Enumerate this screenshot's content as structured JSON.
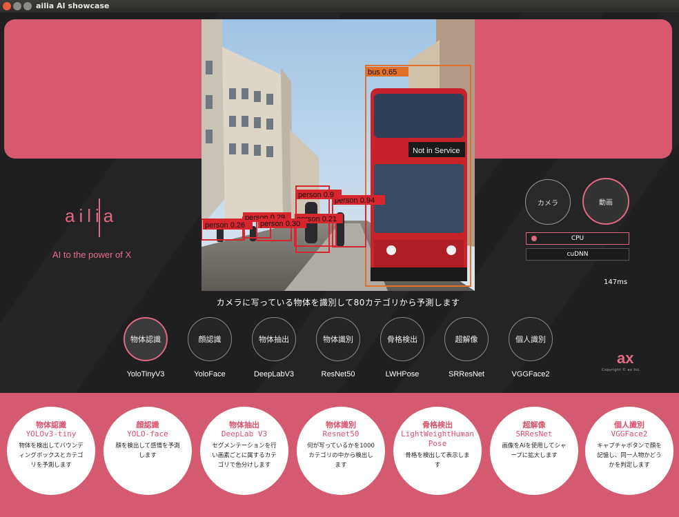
{
  "window": {
    "title": "ailia AI showcase",
    "controls": [
      {
        "name": "close",
        "color": "#e95a3b"
      },
      {
        "name": "minimize",
        "color": "#8b8a85"
      },
      {
        "name": "maximize",
        "color": "#8b8a85"
      }
    ]
  },
  "brand": {
    "logo_text": "ailia",
    "tagline": "AI to the power of X",
    "accent_color": "#e06a80",
    "panel_color": "#d6596f"
  },
  "video": {
    "detections": [
      {
        "label": "bus 0.65"
      },
      {
        "label": "person 0.94"
      },
      {
        "label": "person 0.9"
      },
      {
        "label": "person 0.21"
      },
      {
        "label": "person 0.29"
      },
      {
        "label": "person 0.30"
      },
      {
        "label": "person 0.26"
      }
    ],
    "bus_sign": "Not in Service",
    "caption": "カメラに写っている物体を識別して80カテゴリから予測します"
  },
  "source_buttons": {
    "camera": "カメラ",
    "video": "動画"
  },
  "backend": {
    "options": [
      "CPU",
      "cuDNN"
    ],
    "selected": "CPU"
  },
  "timing": "147ms",
  "modes": [
    {
      "button": "物体認識",
      "label": "YoloTinyV3",
      "active": true
    },
    {
      "button": "顔認識",
      "label": "YoloFace"
    },
    {
      "button": "物体抽出",
      "label": "DeepLabV3"
    },
    {
      "button": "物体識別",
      "label": "ResNet50"
    },
    {
      "button": "骨格検出",
      "label": "LWHPose"
    },
    {
      "button": "超解像",
      "label": "SRResNet"
    },
    {
      "button": "個人識別",
      "label": "VGGFace2"
    }
  ],
  "footer_brand": {
    "logo_text": "ax",
    "copyright": "Copyright © ax Inc."
  },
  "info_cards": [
    {
      "title": "物体認識",
      "model": "YOLOv3-tiny",
      "desc": "物体を検出してバウンディングボックスとカテゴリを予測します"
    },
    {
      "title": "顔認識",
      "model": "YOLO-face",
      "desc": "顔を検出して感情を予測します"
    },
    {
      "title": "物体抽出",
      "model": "DeepLab V3",
      "desc": "セグメンテーションを行い画素ごとに属するカテゴリで色分けします"
    },
    {
      "title": "物体識別",
      "model": "Resnet50",
      "desc": "何が写っているかを1000 カテゴリの中から検出します"
    },
    {
      "title": "骨格検出",
      "model": "LightWeightHuman Pose",
      "desc": "骨格を検出して表示します"
    },
    {
      "title": "超解像",
      "model": "SRResNet",
      "desc": "画像をAIを使用してシャープに拡大します"
    },
    {
      "title": "個人識別",
      "model": "VGGFace2",
      "desc": "キャプチャボタンで顔を記憶し、同一人物かどうかを判定します"
    }
  ]
}
